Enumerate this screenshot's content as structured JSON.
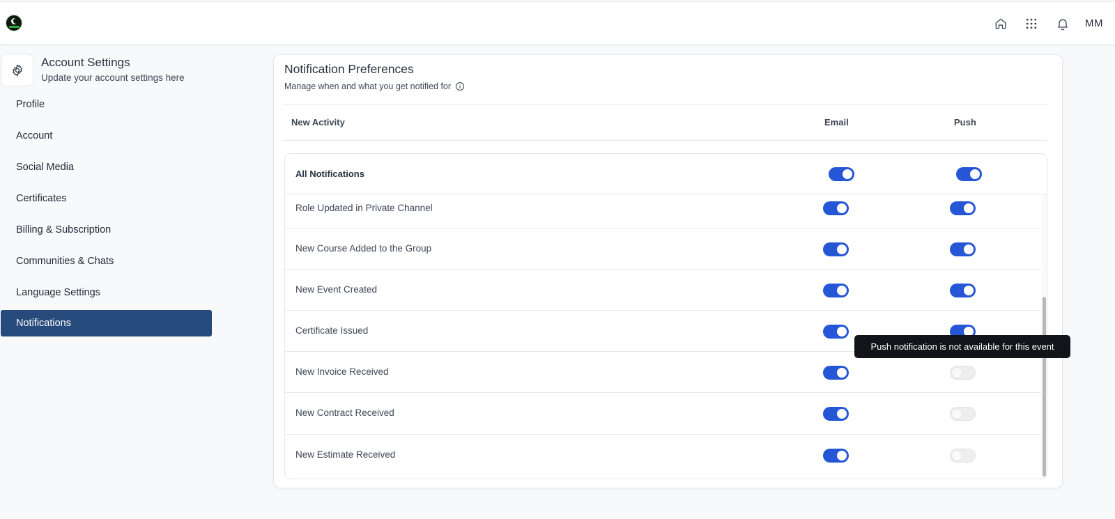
{
  "header": {
    "icons": [
      "home-icon",
      "apps-grid-icon",
      "bell-icon"
    ],
    "avatar_initials": "MM"
  },
  "settings": {
    "title": "Account Settings",
    "subtitle": "Update your account settings here"
  },
  "sidebar": {
    "items": [
      {
        "label": "Profile",
        "active": false
      },
      {
        "label": "Account",
        "active": false
      },
      {
        "label": "Social Media",
        "active": false
      },
      {
        "label": "Certificates",
        "active": false
      },
      {
        "label": "Billing & Subscription",
        "active": false
      },
      {
        "label": "Communities & Chats",
        "active": false
      },
      {
        "label": "Language Settings",
        "active": false
      },
      {
        "label": "Notifications",
        "active": true
      }
    ]
  },
  "notifications": {
    "title": "Notification Preferences",
    "subtitle": "Manage when and what you get notified for",
    "columns": {
      "activity": "New Activity",
      "email": "Email",
      "push": "Push"
    },
    "all": {
      "label": "All Notifications",
      "email": true,
      "push": true
    },
    "rows": [
      {
        "label": "Role Updated in Private Channel",
        "email": true,
        "push": true,
        "push_available": true
      },
      {
        "label": "New Course Added to the Group",
        "email": true,
        "push": true,
        "push_available": true
      },
      {
        "label": "New Event Created",
        "email": true,
        "push": true,
        "push_available": true
      },
      {
        "label": "Certificate Issued",
        "email": true,
        "push": true,
        "push_available": true
      },
      {
        "label": "New Invoice Received",
        "email": true,
        "push": false,
        "push_available": false
      },
      {
        "label": "New Contract Received",
        "email": true,
        "push": false,
        "push_available": false
      },
      {
        "label": "New Estimate Received",
        "email": true,
        "push": false,
        "push_available": false
      }
    ],
    "tooltip": "Push notification is not available for this event"
  },
  "colors": {
    "accent": "#2556d6",
    "sidebar_active": "#274a7d",
    "tooltip_bg": "#111418"
  }
}
